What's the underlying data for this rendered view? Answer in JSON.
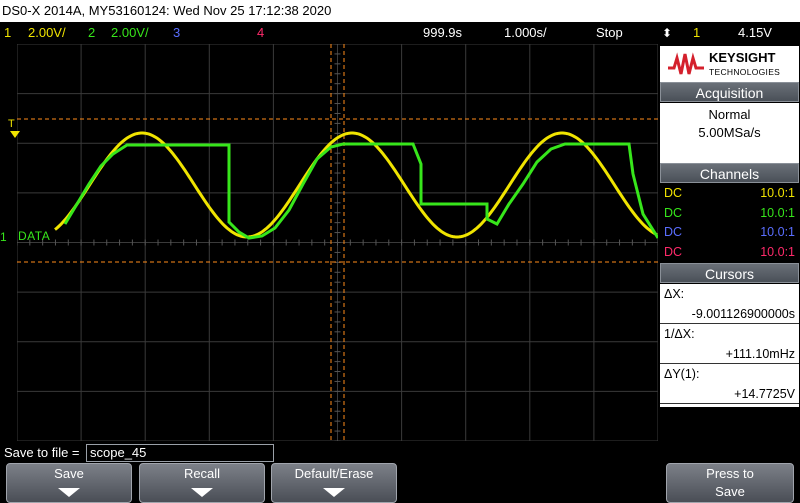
{
  "title": "DS0-X 2014A, MY53160124: Wed Nov 25 17:12:38 2020",
  "status": {
    "ch1_num": "1",
    "ch1_scale": "2.00V/",
    "ch2_num": "2",
    "ch2_scale": "2.00V/",
    "ch3_num": "3",
    "ch4_num": "4",
    "delay": "999.9s",
    "timebase": "1.000s/",
    "run_state": "Stop",
    "trigger_icon": "trigger-edge-icon",
    "trigger_ch": "1",
    "trigger_level": "4.15V"
  },
  "scope": {
    "trigger_marker": "T",
    "ground_marker": "1",
    "digital_label": "DATA"
  },
  "logo": {
    "name": "KEYSIGHT",
    "sub": "TECHNOLOGIES"
  },
  "acquisition": {
    "header": "Acquisition",
    "mode": "Normal",
    "rate": "5.00MSa/s"
  },
  "channels": {
    "header": "Channels",
    "rows": [
      {
        "coupling": "DC",
        "probe": "10.0:1",
        "color": "#f0e400"
      },
      {
        "coupling": "DC",
        "probe": "10.0:1",
        "color": "#37e61b"
      },
      {
        "coupling": "DC",
        "probe": "10.0:1",
        "color": "#5a6eff"
      },
      {
        "coupling": "DC",
        "probe": "10.0:1",
        "color": "#ff2a6a"
      }
    ]
  },
  "cursors": {
    "header": "Cursors",
    "dx_label": "ΔX:",
    "dx_value": "-9.001126900000s",
    "inv_dx_label": "1/ΔX:",
    "inv_dx_value": "+111.10mHz",
    "dy_label": "ΔY(1):",
    "dy_value": "+14.7725V"
  },
  "save": {
    "label": "Save to file =",
    "filename": "scope_45"
  },
  "softkeys": {
    "save": "Save",
    "recall": "Recall",
    "default_erase": "Default/Erase",
    "press_to_1": "Press to",
    "press_to_2": "Save"
  },
  "colors": {
    "ch1": "#f0e400",
    "ch2": "#37e61b",
    "cursor": "#ff8c1a",
    "grid": "#3a3a3a"
  }
}
